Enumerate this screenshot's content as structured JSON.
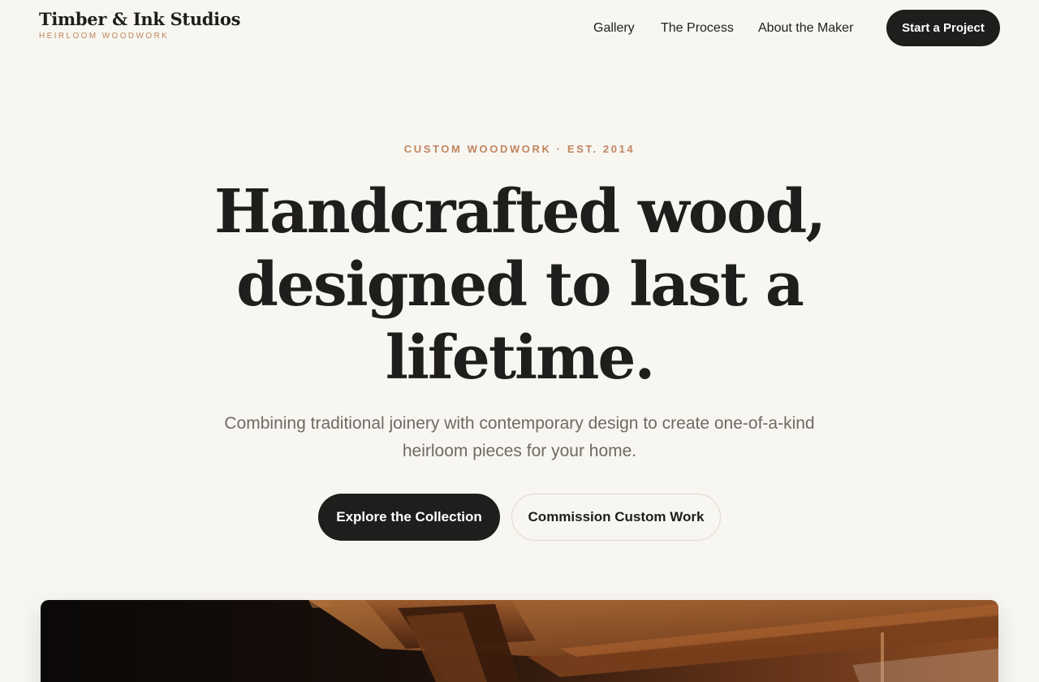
{
  "brand": {
    "name": "Timber & Ink Studios",
    "tagline": "HEIRLOOM WOODWORK"
  },
  "nav": {
    "items": [
      {
        "label": "Gallery"
      },
      {
        "label": "The Process"
      },
      {
        "label": "About the Maker"
      }
    ],
    "cta_label": "Start a Project"
  },
  "hero": {
    "eyebrow": "CUSTOM WOODWORK · EST. 2014",
    "headline": "Handcrafted wood, designed to last a lifetime.",
    "subhead": "Combining traditional joinery with contemporary design to create one-of-a-kind heirloom pieces for your home.",
    "primary_button": "Explore the Collection",
    "secondary_button": "Commission Custom Work"
  },
  "colors": {
    "background": "#f8f6f1",
    "ink": "#1f1e1c",
    "accent": "#c08560",
    "muted_text": "#6e6a64"
  },
  "image": {
    "subject": "woodworking-shelf-photo"
  }
}
